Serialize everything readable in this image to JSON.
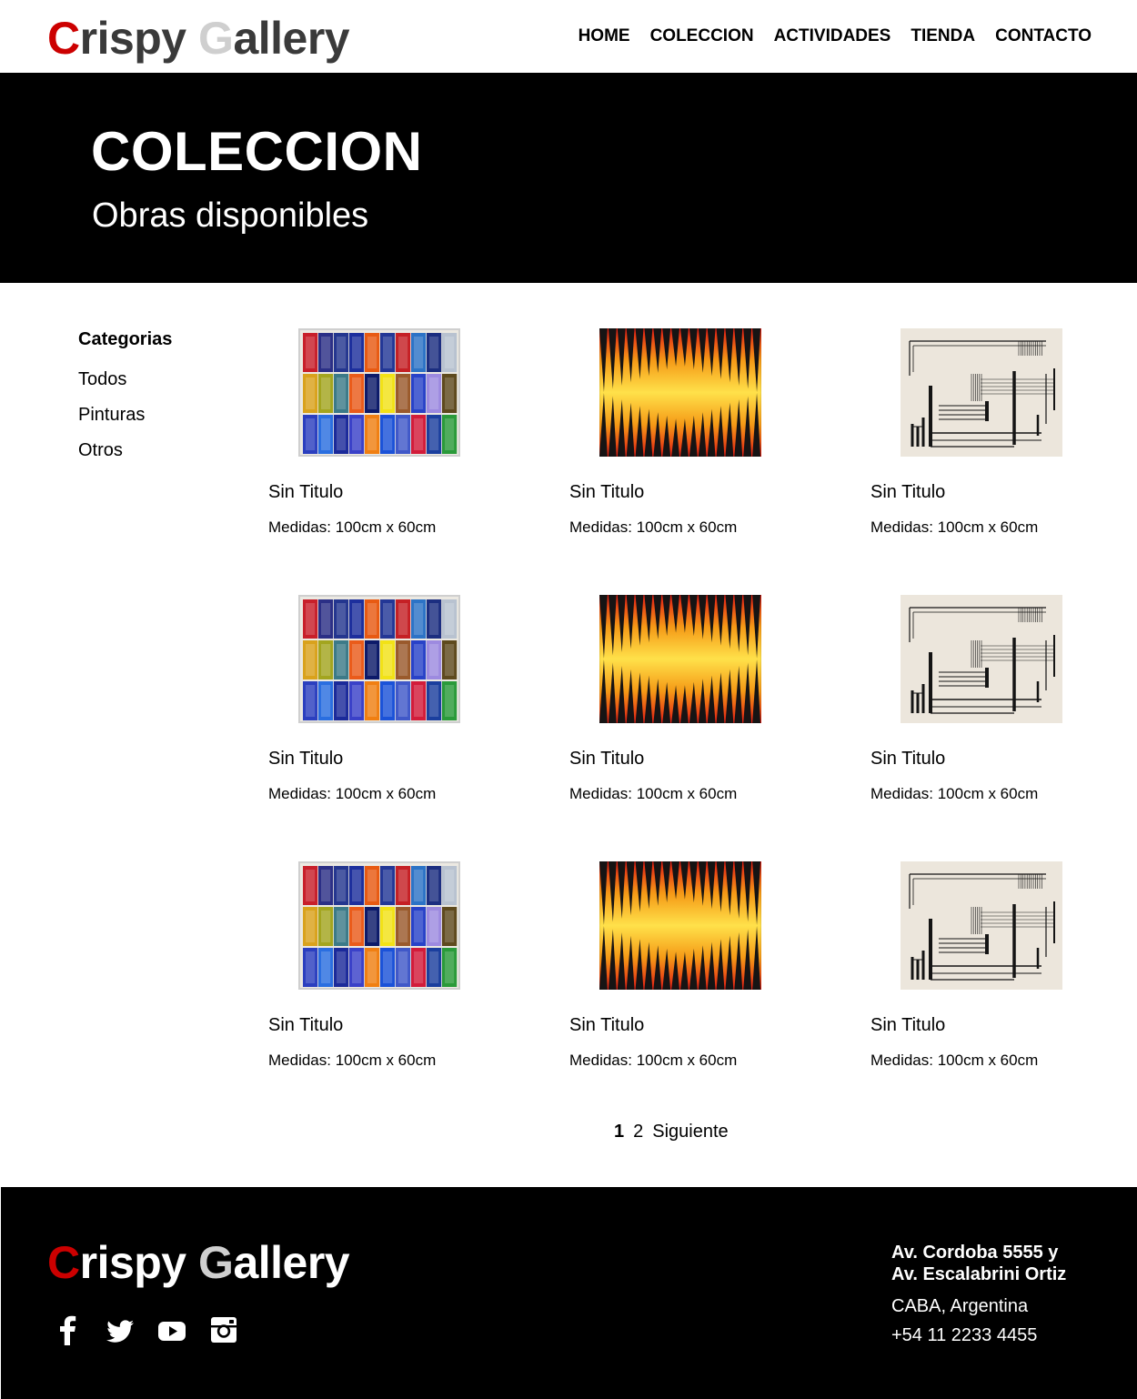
{
  "brand": {
    "initial1": "C",
    "word1": "rispy",
    "initial2": "G",
    "word2": "allery"
  },
  "nav": {
    "items": [
      "HOME",
      "COLECCION",
      "ACTIVIDADES",
      "TIENDA",
      "CONTACTO"
    ]
  },
  "hero": {
    "title": "COLECCION",
    "subtitle": "Obras disponibles"
  },
  "sidebar": {
    "title": "Categorias",
    "items": [
      "Todos",
      "Pinturas",
      "Otros"
    ]
  },
  "artworks": [
    {
      "title": "Sin Titulo",
      "size": "Medidas: 100cm x 60cm",
      "image": "colored-glass-grid"
    },
    {
      "title": "Sin Titulo",
      "size": "Medidas: 100cm x 60cm",
      "image": "red-yellow-optical-pattern"
    },
    {
      "title": "Sin Titulo",
      "size": "Medidas: 100cm x 60cm",
      "image": "black-line-composition"
    },
    {
      "title": "Sin Titulo",
      "size": "Medidas: 100cm x 60cm",
      "image": "colored-glass-grid"
    },
    {
      "title": "Sin Titulo",
      "size": "Medidas: 100cm x 60cm",
      "image": "red-yellow-optical-pattern"
    },
    {
      "title": "Sin Titulo",
      "size": "Medidas: 100cm x 60cm",
      "image": "black-line-composition"
    },
    {
      "title": "Sin Titulo",
      "size": "Medidas: 100cm x 60cm",
      "image": "colored-glass-grid"
    },
    {
      "title": "Sin Titulo",
      "size": "Medidas: 100cm x 60cm",
      "image": "red-yellow-optical-pattern"
    },
    {
      "title": "Sin Titulo",
      "size": "Medidas: 100cm x 60cm",
      "image": "black-line-composition"
    }
  ],
  "pagination": {
    "current": "1",
    "next_page": "2",
    "next_label": "Siguiente"
  },
  "footer": {
    "address_line1": "Av. Cordoba 5555 y",
    "address_line2": "Av. Escalabrini Ortiz",
    "city": "CABA, Argentina",
    "phone": "+54 11 2233 4455",
    "socials": [
      "facebook-icon",
      "twitter-icon",
      "youtube-icon",
      "instagram-icon"
    ]
  },
  "colors": {
    "accent": "#cc0000",
    "hero_bg": "#000000",
    "logo_gray": "#cfcfcf"
  }
}
